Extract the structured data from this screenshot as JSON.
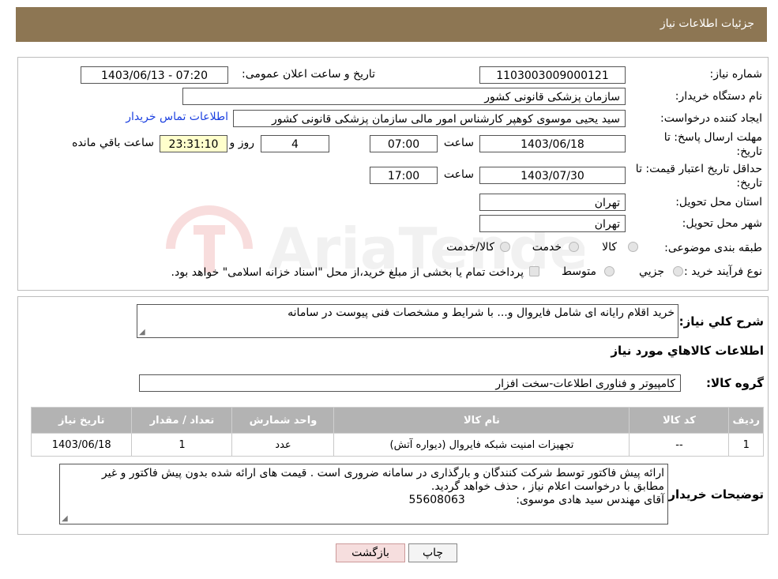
{
  "header": {
    "title": "جزئیات اطلاعات نیاز"
  },
  "form": {
    "need_number_label": "شماره نیاز:",
    "need_number": "1103003009000121",
    "announce_label": "تاریخ و ساعت اعلان عمومی:",
    "announce_value": "1403/06/13 - 07:20",
    "buyer_org_label": "نام دستگاه خریدار:",
    "buyer_org": "سازمان پزشکی قانونی کشور",
    "requester_label": "ایجاد کننده درخواست:",
    "requester": "سید یحیی موسوی کوهپر کارشناس امور مالی سازمان پزشکی قانونی کشور",
    "contact_link": "اطلاعات تماس خریدار",
    "deadline_label_1": "مهلت ارسال پاسخ: تا",
    "deadline_label_2": "تاریخ:",
    "deadline_date": "1403/06/18",
    "time_label": "ساعت",
    "deadline_time": "07:00",
    "days_value": "4",
    "days_label": "روز و",
    "remaining_time": "23:31:10",
    "remaining_label": "ساعت باقي مانده",
    "validity_label_1": "حداقل تاریخ اعتبار قیمت: تا",
    "validity_label_2": "تاریخ:",
    "validity_date": "1403/07/30",
    "validity_time": "17:00",
    "province_label": "استان محل تحویل:",
    "province": "تهران",
    "city_label": "شهر محل تحویل:",
    "city": "تهران",
    "category_label": "طبقه بندی موضوعی:",
    "category_options": [
      "کالا",
      "خدمت",
      "کالا/خدمت"
    ],
    "process_label": "نوع فرآیند خرید :",
    "process_options": [
      "جزیي",
      "متوسط"
    ],
    "payment_note": "پرداخت تمام یا بخشی از مبلغ خرید،از محل \"اسناد خزانه اسلامی\" خواهد بود."
  },
  "details": {
    "summary_label": "شرح کلي نياز:",
    "summary": "خرید اقلام رایانه ای شامل فایروال و... با شرایط و مشخصات فنی  پیوست در سامانه",
    "goods_info_title": "اطلاعات کالاهاي مورد نياز",
    "goods_group_label": "گروه کالا:",
    "goods_group": "کامپیوتر و فناوری اطلاعات-سخت افزار"
  },
  "table": {
    "headers": [
      "رديف",
      "کد کالا",
      "نام کالا",
      "واحد شمارش",
      "تعداد / مقدار",
      "تاریخ نیاز"
    ],
    "rows": [
      [
        "1",
        "--",
        "تجهیزات امنیت شبکه فایروال (دیواره آتش)",
        "عدد",
        "1",
        "1403/06/18"
      ]
    ]
  },
  "buyer_notes": {
    "label": "توضيحات خريدار:",
    "line1": "ارائه پیش فاکتور  توسط شرکت کنندگان و بارگذاری در سامانه ضروری است . قیمت های ارائه شده بدون پیش فاکتور  و غیر",
    "line2": "مطابق با درخواست اعلام نیاز  ،  حذف خواهد گردید.",
    "line3_name": "آقای مهندس سید هادی موسوی:",
    "line3_phone": "55608063"
  },
  "buttons": {
    "print": "چاپ",
    "back": "بازگشت"
  },
  "watermark": {
    "text": "AriaTender.neT"
  },
  "colors": {
    "header": "#8d7653",
    "link": "#1a3fe0",
    "table_header": "#b3b3b3",
    "back_button": "#f6dede"
  }
}
